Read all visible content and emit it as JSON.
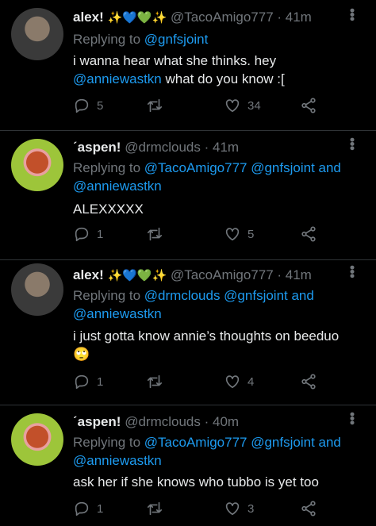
{
  "tweets": [
    {
      "name": "alex!",
      "emojis": "✨💙💚✨",
      "handle": "@TacoAmigo777",
      "time": "· 41m",
      "replying_prefix": "Replying to ",
      "replying_to": "@gnfsjoint",
      "body_line1": "i wanna hear what she thinks. hey",
      "body_mention": "@anniewastkn",
      "body_line2": " what do you know :[",
      "replies": "5",
      "retweets": "",
      "likes": "34",
      "avatar_color": "#3a3a3a"
    },
    {
      "name": "ˊaspen!",
      "handle": "@drmclouds",
      "time": "· 41m",
      "replying_prefix": "Replying to ",
      "replying_to": "@TacoAmigo777 @gnfsjoint and @anniewastkn",
      "body": "ALEXXXXX",
      "replies": "1",
      "retweets": "",
      "likes": "5",
      "avatar_color": "#9dc53a"
    },
    {
      "name": "alex!",
      "emojis": "✨💙💚✨",
      "handle": "@TacoAmigo777",
      "time": "· 41m",
      "replying_prefix": "Replying to ",
      "replying_to": "@drmclouds @gnfsjoint and @anniewastkn",
      "body": "i just gotta know annie’s thoughts on beeduo",
      "body_emoji": "🙄",
      "replies": "1",
      "retweets": "",
      "likes": "4",
      "avatar_color": "#3a3a3a"
    },
    {
      "name": "ˊaspen!",
      "handle": "@drmclouds",
      "time": "· 40m",
      "replying_prefix": "Replying to ",
      "replying_to": "@TacoAmigo777 @gnfsjoint and @anniewastkn",
      "body": "ask her if she knows who tubbo is yet too",
      "replies": "1",
      "retweets": "",
      "likes": "3",
      "avatar_color": "#9dc53a"
    }
  ],
  "icons": [
    "reply-icon",
    "retweet-icon",
    "like-icon",
    "share-icon",
    "more-icon"
  ]
}
